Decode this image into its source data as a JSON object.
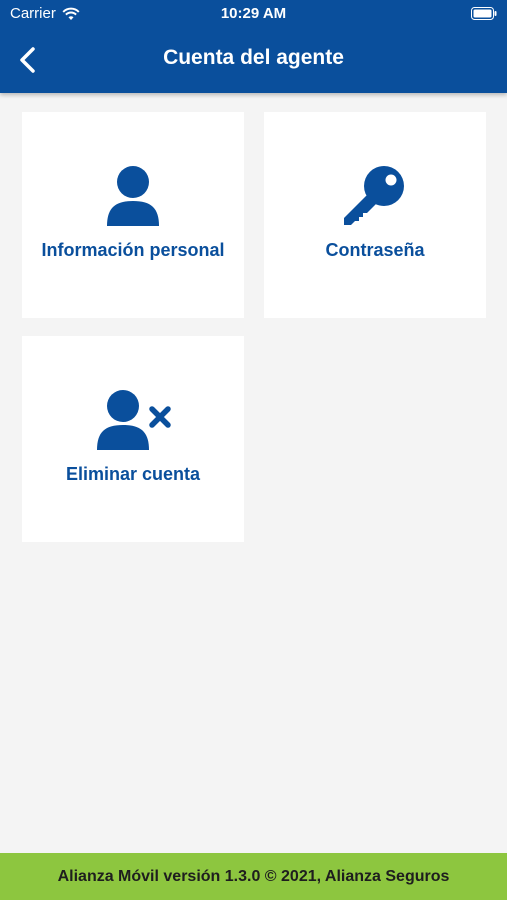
{
  "status_bar": {
    "carrier": "Carrier",
    "time": "10:29 AM",
    "wifi_icon": "wifi-icon",
    "battery_icon": "battery-icon"
  },
  "header": {
    "title": "Cuenta del agente",
    "back_icon": "chevron-left-icon",
    "background_color": "#0a4f9c"
  },
  "cards": [
    {
      "label": "Información personal",
      "icon": "user-icon"
    },
    {
      "label": "Contraseña",
      "icon": "key-icon"
    },
    {
      "label": "Eliminar cuenta",
      "icon": "user-remove-icon"
    }
  ],
  "footer": {
    "text": "Alianza Móvil versión 1.3.0 © 2021, Alianza Seguros",
    "background_color": "#8dc63f"
  },
  "colors": {
    "accent": "#0a4f9c",
    "page_background": "#f4f4f4"
  }
}
